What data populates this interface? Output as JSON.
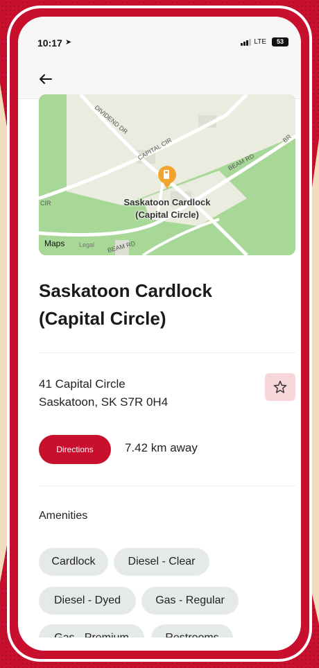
{
  "status_bar": {
    "time": "10:17",
    "network": "LTE",
    "battery": "53"
  },
  "icons": {
    "back": "arrow-left-icon",
    "location": "location-arrow-icon",
    "favorite": "star-outline-icon",
    "fuel": "fuel-pump-icon"
  },
  "map": {
    "title_line1": "Saskatoon Cardlock",
    "title_line2": "(Capital Circle)",
    "streets": {
      "dividend": "DIVIDEND DR",
      "capital": "CAPITAL CIR",
      "beam_top": "BEAM RD",
      "beam_bottom": "BEAM RD",
      "cir_left": "CIR",
      "br": "BR"
    },
    "maps_brand": "Maps",
    "legal": "Legal"
  },
  "location": {
    "name_line1": "Saskatoon Cardlock",
    "name_line2": "(Capital Circle)",
    "address_line1": "41 Capital Circle",
    "address_line2": "Saskatoon, SK S7R 0H4"
  },
  "actions": {
    "directions_label": "Directions",
    "distance": "7.42 km away"
  },
  "amenities": {
    "heading": "Amenities",
    "items": [
      "Cardlock",
      "Diesel - Clear",
      "Diesel - Dyed",
      "Gas - Regular",
      "Gas - Premium",
      "Restrooms"
    ]
  },
  "colors": {
    "brand_red": "#c8102e",
    "chip_bg": "#e6e9ea",
    "fav_bg": "#f8d7da",
    "map_green": "#a8d897",
    "map_land": "#e9ecdf",
    "pin": "#f2a42e"
  }
}
